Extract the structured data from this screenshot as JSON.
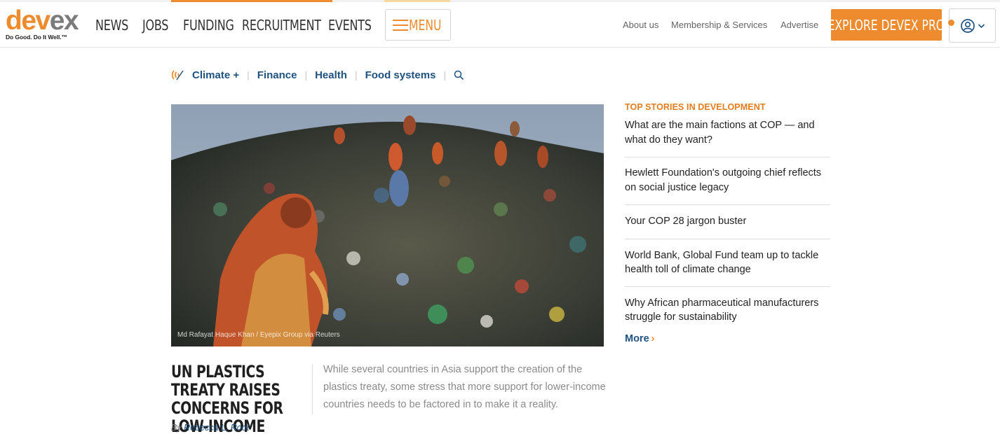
{
  "header": {
    "logo": {
      "word_a": "dev",
      "word_b": "ex",
      "tagline": "Do Good. Do It Well.™"
    },
    "nav": [
      "NEWS",
      "JOBS",
      "FUNDING",
      "RECRUITMENT",
      "EVENTS"
    ],
    "menu_label": "MENU",
    "utility_links": [
      "About us",
      "Membership & Services",
      "Advertise"
    ],
    "pro_button": "EXPLORE DEVEX PRO",
    "account_icon": "user-circle-icon"
  },
  "topics": {
    "icon": "climate-icon",
    "items": [
      "Climate +",
      "Finance",
      "Health",
      "Food systems"
    ],
    "search_icon": "search-icon"
  },
  "feature": {
    "image_credit": "Md Rafayat Haque Khan / Eyepix Group via Reuters",
    "headline": "UN PLASTICS TREATY RAISES CONCERNS FOR LOW-INCOME COUNTRIES",
    "byline_prefix": "By",
    "author": "Rebecca L. Root",
    "summary": "While several countries in Asia support the creation of the plastics treaty, some stress that more support for lower-income countries needs to be factored in to make it a reality."
  },
  "sidebar": {
    "title": "TOP STORIES IN DEVELOPMENT",
    "stories": [
      "What are the main factions at COP — and what do they want?",
      "Hewlett Foundation's outgoing chief reflects on social justice legacy",
      "Your COP 28 jargon buster",
      "World Bank, Global Fund team up to tackle health toll of climate change",
      "Why African pharmaceutical manufacturers struggle for sustainability"
    ],
    "more_label": "More",
    "more_chevron": "›"
  },
  "colors": {
    "brand_orange": "#ee8b2e",
    "link_blue": "#20527f",
    "logo_gray": "#7b7b7b"
  }
}
